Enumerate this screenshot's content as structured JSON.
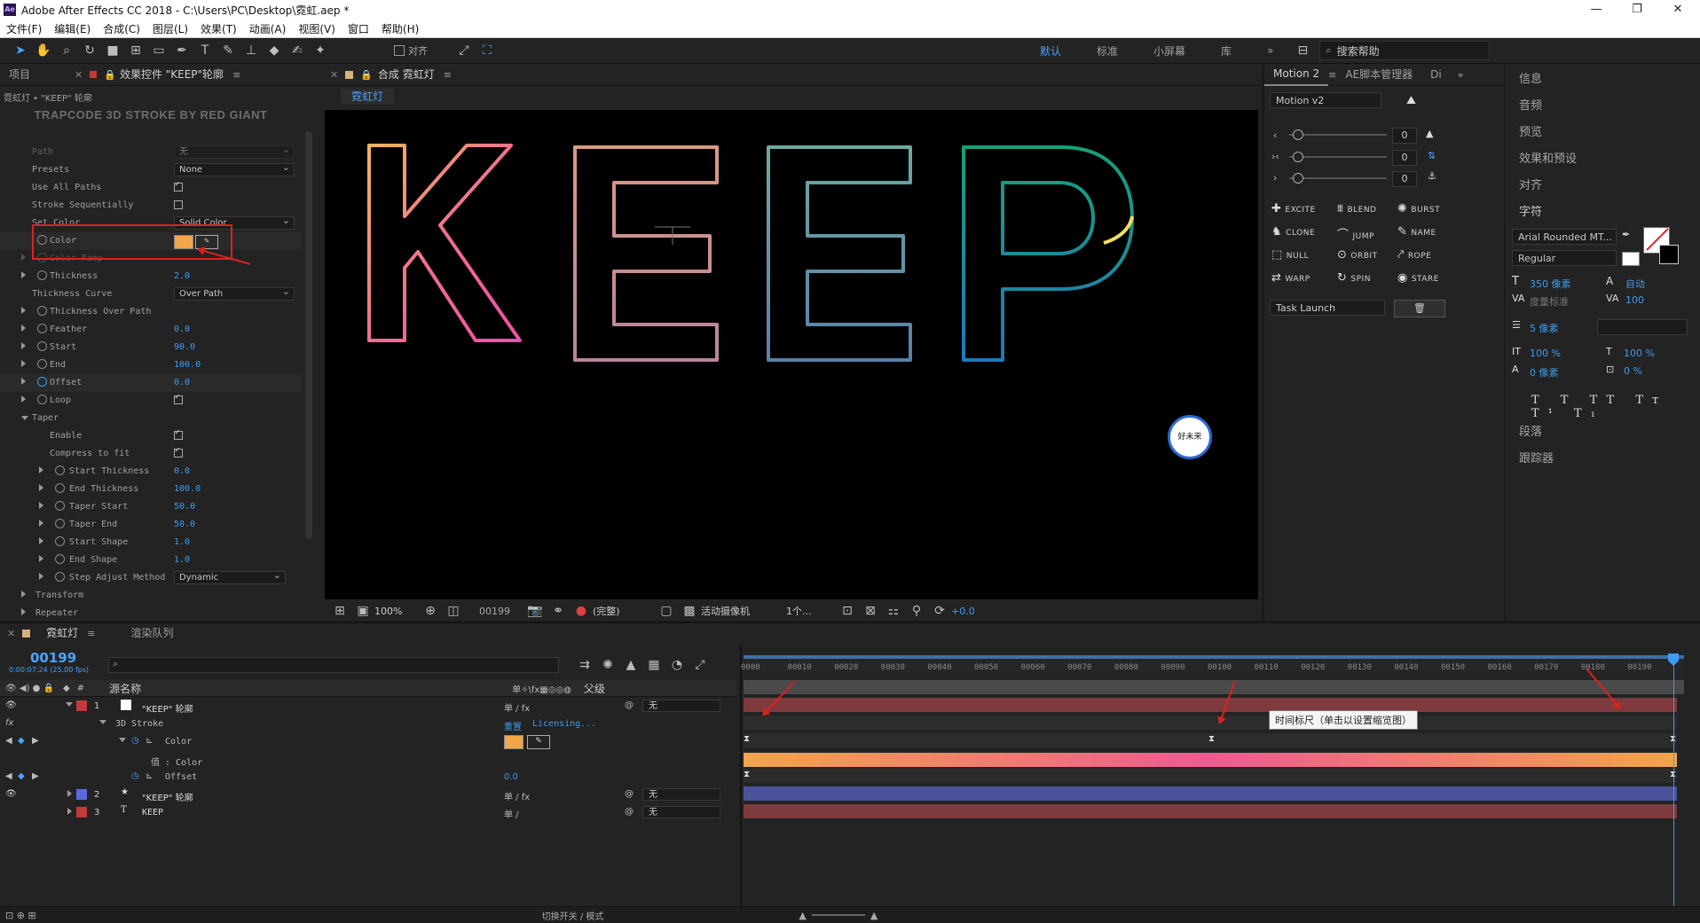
{
  "window": {
    "title": "Adobe After Effects CC 2018 - C:\\Users\\PC\\Desktop\\霓虹.aep *",
    "app_icon": "Ae"
  },
  "menu": [
    "文件(F)",
    "编辑(E)",
    "合成(C)",
    "图层(L)",
    "效果(T)",
    "动画(A)",
    "视图(V)",
    "窗口",
    "帮助(H)"
  ],
  "toolbar": {
    "align_label": "对齐",
    "workspaces": [
      "默认",
      "标准",
      "小屏幕",
      "库"
    ],
    "search_placeholder": "搜索帮助"
  },
  "effects_panel": {
    "tab_project": "项目",
    "tab_effects": "效果控件 \"KEEP\"轮廓",
    "breadcrumb": "霓虹灯 • \"KEEP\" 轮廓",
    "plugin_title": "TRAPCODE 3D STROKE BY RED GIANT",
    "rows": {
      "path": "Path",
      "path_val": "无",
      "presets": "Presets",
      "presets_val": "None",
      "use_all_paths": "Use All Paths",
      "stroke_seq": "Stroke Sequentially",
      "set_color": "Set Color",
      "set_color_val": "Solid Color",
      "color": "Color",
      "color_ramp": "Color Ramp",
      "thickness": "Thickness",
      "thickness_val": "2.0",
      "thickness_curve": "Thickness Curve",
      "thickness_curve_val": "Over Path",
      "thickness_over_path": "Thickness Over Path",
      "feather": "Feather",
      "feather_val": "0.0",
      "start": "Start",
      "start_val": "90.0",
      "end": "End",
      "end_val": "100.0",
      "offset": "Offset",
      "offset_val": "0.0",
      "loop": "Loop",
      "taper": "Taper",
      "enable": "Enable",
      "compress": "Compress to fit",
      "start_thickness": "Start Thickness",
      "start_thickness_val": "0.0",
      "end_thickness": "End Thickness",
      "end_thickness_val": "100.0",
      "taper_start": "Taper Start",
      "taper_start_val": "50.0",
      "taper_end": "Taper End",
      "taper_end_val": "50.0",
      "start_shape": "Start Shape",
      "start_shape_val": "1.0",
      "end_shape": "End Shape",
      "end_shape_val": "1.0",
      "step_adjust": "Step Adjust Method",
      "step_adjust_val": "Dynamic",
      "transform": "Transform",
      "repeater": "Repeater"
    },
    "color_swatch": "#f2a54a"
  },
  "composition": {
    "tab_label": "合成 霓虹灯",
    "subtab": "霓虹灯",
    "text": "KEEP",
    "zoom": "100%",
    "frame": "00199",
    "resolution": "(完整)",
    "camera": "活动摄像机",
    "views": "1个...",
    "exposure": "+0.0",
    "logo_text": "好未来"
  },
  "motion_panel": {
    "tab1": "Motion 2",
    "tab2": "AE脚本管理器",
    "tab3": "Di",
    "version": "Motion v2",
    "slider_values": [
      "0",
      "0",
      "0"
    ],
    "buttons": [
      "EXCITE",
      "BLEND",
      "BURST",
      "CLONE",
      "JUMP",
      "NAME",
      "NULL",
      "ORBIT",
      "ROPE",
      "WARP",
      "SPIN",
      "STARE"
    ],
    "task": "Task Launch"
  },
  "right_panels": {
    "items": [
      "信息",
      "音频",
      "预览",
      "效果和预设",
      "对齐"
    ],
    "character": "字符",
    "font": "Arial Rounded MT...",
    "style": "Regular",
    "size": "350 像素",
    "leading": "自动",
    "kerning": "度量标准",
    "tracking": "100",
    "stroke": "5 像素",
    "vscale": "100 %",
    "hscale": "100 %",
    "baseline": "0 像素",
    "tsume": "0 %",
    "paragraph": "段落",
    "tracker": "跟踪器"
  },
  "timeline": {
    "tab": "霓虹灯",
    "tab_render": "渲染队列",
    "timecode": "00199",
    "timecode_sub": "0:00:07:24 (25.00 fps)",
    "col_name": "源名称",
    "col_parent": "父级",
    "ticks": [
      "0000",
      "00010",
      "00020",
      "00030",
      "00040",
      "00050",
      "00060",
      "00070",
      "00080",
      "00090",
      "00100",
      "00110",
      "00120",
      "00130",
      "00140",
      "00150",
      "00160",
      "00170",
      "00180",
      "00190"
    ],
    "tooltip": "时间标尺（单击以设置缩览图）",
    "layers": [
      {
        "num": "1",
        "name": "\"KEEP\" 轮廓",
        "parent": "无",
        "color": "#c23a3a"
      },
      {
        "num": "2",
        "name": "\"KEEP\" 轮廓",
        "parent": "无",
        "color": "#5a6adc"
      },
      {
        "num": "3",
        "name": "KEEP",
        "parent": "无",
        "color": "#c23a3a"
      }
    ],
    "sub": {
      "stroke": "3D Stroke",
      "reset": "重置",
      "licensing": "Licensing...",
      "color": "Color",
      "value_color": "值 : Color",
      "offset": "Offset",
      "offset_val": "0.0"
    },
    "footer": "切换开关 / 模式"
  }
}
